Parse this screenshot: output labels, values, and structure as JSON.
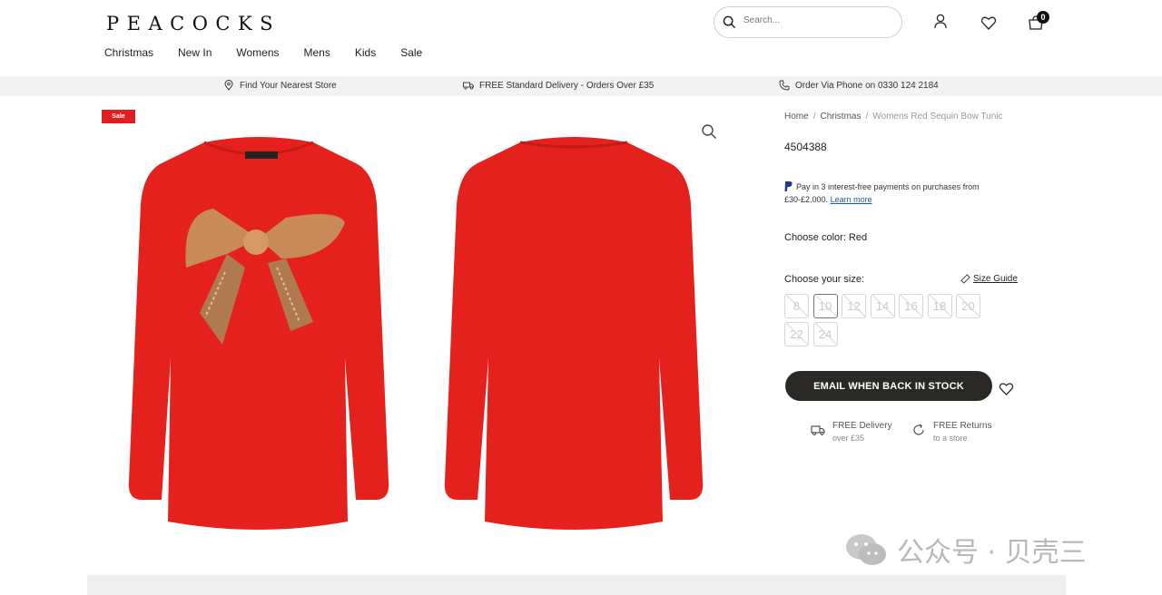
{
  "header": {
    "logo": "PEACOCKS",
    "search_placeholder": "Search...",
    "cart_count": "0"
  },
  "nav": [
    "Christmas",
    "New In",
    "Womens",
    "Mens",
    "Kids",
    "Sale"
  ],
  "strip": {
    "store": "Find Your Nearest Store",
    "delivery": "FREE Standard Delivery - Orders Over £35",
    "phone": "Order Via Phone on 0330 124 2184"
  },
  "product": {
    "badge": "Sale",
    "breadcrumb": [
      "Home",
      "Christmas",
      "Womens Red Sequin Bow Tunic"
    ],
    "sku": "4504388",
    "paypal_text": "Pay in 3 interest-free payments on purchases from £30-£2,000.",
    "paypal_link": "Learn more",
    "color_label": "Choose color: Red",
    "size_label": "Choose your size:",
    "size_guide": "Size Guide",
    "sizes": [
      "8",
      "10",
      "12",
      "14",
      "16",
      "18",
      "20",
      "22",
      "24"
    ],
    "email_button": "EMAIL WHEN BACK IN STOCK",
    "perks": [
      {
        "title": "FREE Delivery",
        "sub": "over £35"
      },
      {
        "title": "FREE Returns",
        "sub": "to a store"
      }
    ],
    "colors": {
      "sweater": "#e5211d",
      "sequin": "#c98a5a",
      "badge": "#e02020",
      "button": "#2b2926"
    }
  },
  "watermark": "公众号 · 贝壳三"
}
